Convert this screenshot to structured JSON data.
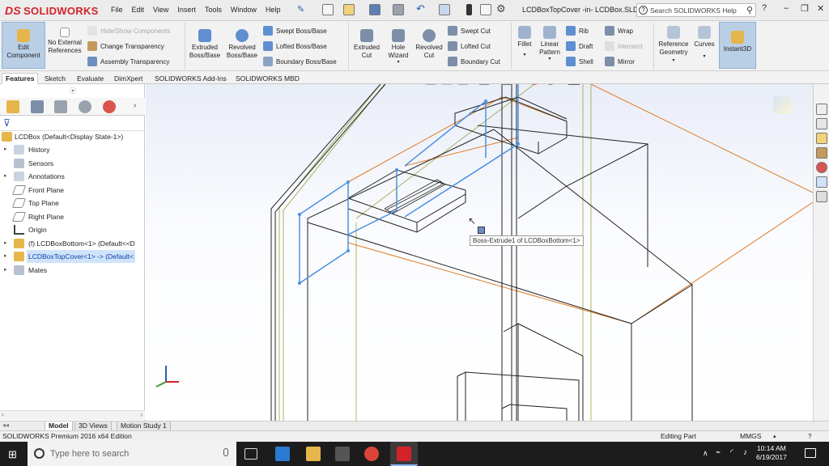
{
  "app": {
    "brand": "SOLIDWORKS",
    "brand_mark": "DS",
    "brand_color": "#d2232a"
  },
  "menu": [
    "File",
    "Edit",
    "View",
    "Insert",
    "Tools",
    "Window",
    "Help"
  ],
  "doc_title": "LCDBoxTopCover -in- LCDBox.SLD...",
  "help_search": {
    "placeholder": "Search SOLIDWORKS Help"
  },
  "ribbon": {
    "edit_component": "Edit Component",
    "no_external_refs": "No External References",
    "hide_show": "Hide/Show Components",
    "change_transparency": "Change Transparency",
    "assembly_transparency": "Assembly Transparency",
    "extruded_boss": "Extruded Boss/Base",
    "revolved_boss": "Revolved Boss/Base",
    "swept_boss": "Swept Boss/Base",
    "lofted_boss": "Lofted Boss/Base",
    "boundary_boss": "Boundary Boss/Base",
    "extruded_cut": "Extruded Cut",
    "hole_wizard": "Hole Wizard",
    "revolved_cut": "Revolved Cut",
    "swept_cut": "Swept Cut",
    "lofted_cut": "Lofted Cut",
    "boundary_cut": "Boundary Cut",
    "fillet": "Fillet",
    "linear_pattern": "Linear Pattern",
    "rib": "Rib",
    "draft": "Draft",
    "shell": "Shell",
    "wrap": "Wrap",
    "intersect": "Intersect",
    "mirror": "Mirror",
    "reference_geometry": "Reference Geometry",
    "curves": "Curves",
    "instant3d": "Instant3D"
  },
  "tabs": [
    "Features",
    "Sketch",
    "Evaluate",
    "DimXpert",
    "SOLIDWORKS Add-Ins",
    "SOLIDWORKS MBD"
  ],
  "tree": {
    "root": "LCDBox  (Default<Display State-1>)",
    "items": [
      "History",
      "Sensors",
      "Annotations",
      "Front Plane",
      "Top Plane",
      "Right Plane",
      "Origin",
      "(f) LCDBoxBottom<1> (Default<<D",
      "LCDBoxTopCover<1> -> (Default<",
      "Mates"
    ]
  },
  "tooltip": "Boss-Extrude1 of LCDBoxBottom<1>",
  "bottom_tabs": [
    "Model",
    "3D Views",
    "Motion Study 1"
  ],
  "status": {
    "edition": "SOLIDWORKS Premium 2016 x64 Edition",
    "mode": "Editing Part",
    "units": "MMGS"
  },
  "taskbar": {
    "search_placeholder": "Type here to search",
    "time": "10:14 AM",
    "date": "6/19/2017"
  },
  "colors": {
    "selection_blue": "#4a90e2",
    "edge_orange": "#e07b25",
    "edge_olive": "#9aa63a",
    "ribbon_active": "#b9cfe6"
  }
}
